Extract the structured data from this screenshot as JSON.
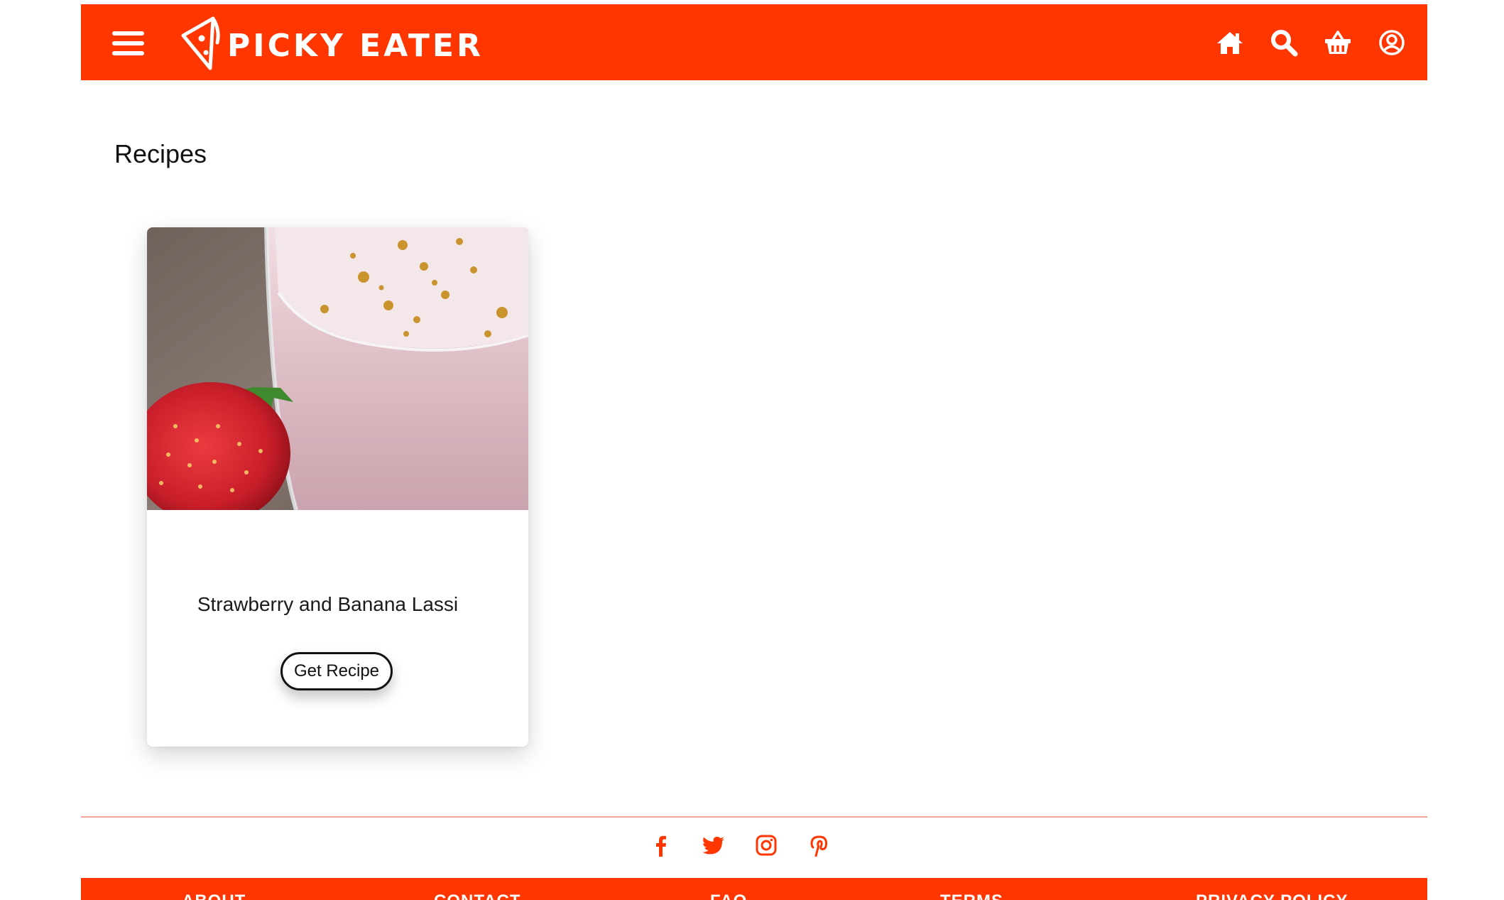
{
  "header": {
    "brand": "PICKY EATER",
    "accent_color": "#ff3600",
    "icons": [
      "menu-icon",
      "home-icon",
      "search-icon",
      "basket-icon",
      "user-icon"
    ]
  },
  "main": {
    "title": "Recipes",
    "cards": [
      {
        "title": "Strawberry and Banana Lassi",
        "button_label": "Get Recipe",
        "image": "strawberry-lassi-glass-with-strawberry"
      }
    ]
  },
  "footer": {
    "social_icons": [
      "facebook-icon",
      "twitter-icon",
      "instagram-icon",
      "pinterest-icon"
    ],
    "links": [
      "ABOUT",
      "CONTACT",
      "FAQ",
      "TERMS",
      "PRIVACY POLICY"
    ]
  }
}
